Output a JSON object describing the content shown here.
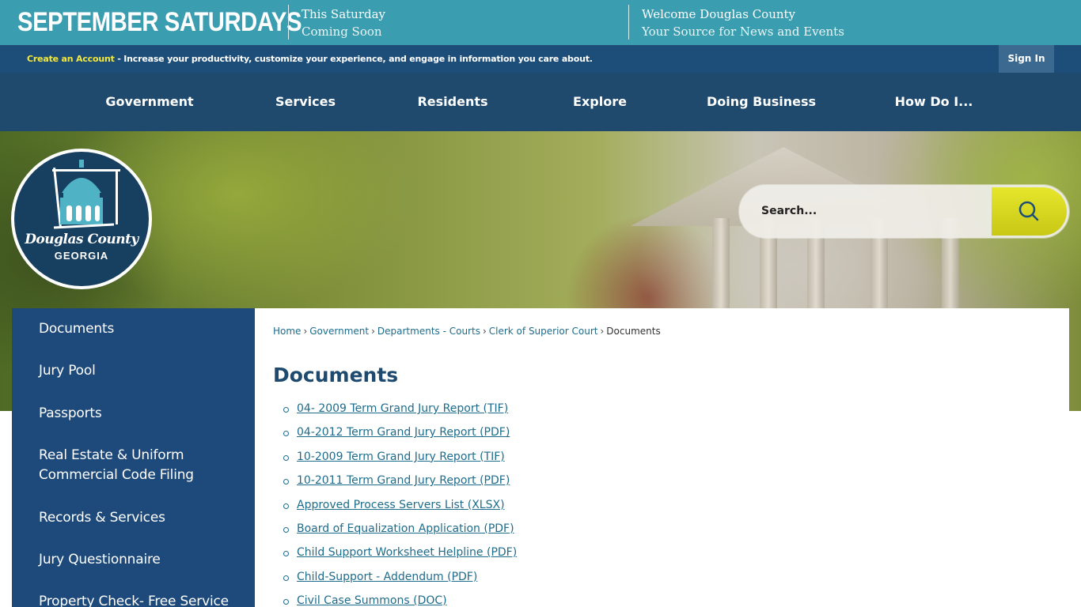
{
  "banner": {
    "title": "SEPTEMBER SATURDAYS",
    "item1": {
      "line1": "This Saturday",
      "line2": "Coming Soon"
    },
    "item2": {
      "line1": "Welcome Douglas County",
      "line2": "Your Source for News and Events"
    }
  },
  "account_bar": {
    "create_link": "Create an Account",
    "message": " - Increase your productivity, customize your experience, and engage in information you care about.",
    "signin": "Sign In"
  },
  "nav": {
    "items": [
      "Government",
      "Services",
      "Residents",
      "Explore",
      "Doing Business",
      "How Do I..."
    ]
  },
  "logo": {
    "text_line1": "Douglas County",
    "text_line2": "GEORGIA"
  },
  "search": {
    "placeholder": "Search..."
  },
  "sidebar": {
    "items": [
      "Documents",
      "Jury Pool",
      "Passports",
      "Real Estate & Uniform Commercial Code Filing",
      "Records & Services",
      "Jury Questionnaire",
      "Property Check- Free Service"
    ]
  },
  "breadcrumb": {
    "items": [
      "Home",
      "Government",
      "Departments - Courts",
      "Clerk of Superior Court"
    ],
    "current": "Documents",
    "separator": "›"
  },
  "page_title": "Documents",
  "documents": [
    "04- 2009 Term Grand Jury Report (TIF)",
    "04-2012 Term Grand Jury Report (PDF)",
    "10-2009 Term Grand Jury Report (TIF)",
    "10-2011 Term Grand Jury Report (PDF)",
    "Approved Process Servers List (XLSX)",
    "Board of Equalization Application (PDF)",
    "Child Support Worksheet Helpline (PDF)",
    "Child-Support - Addendum (PDF)",
    "Civil Case Summons (DOC)"
  ],
  "colors": {
    "banner": "#3a9eb0",
    "account_bar": "#1d4e79",
    "nav": "#1f4a6e",
    "sidebar": "#1d4a7a",
    "link": "#1e6c8c",
    "search_button": "#d8d820",
    "create_account": "#f4e836"
  }
}
